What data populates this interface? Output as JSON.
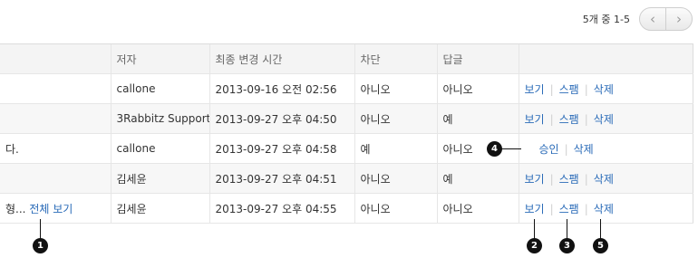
{
  "pagination": {
    "info": "5개 중 1-5",
    "prev_icon": "chevron-left-icon",
    "next_icon": "chevron-right-icon"
  },
  "columns": [
    "",
    "저자",
    "최종 변경 시간",
    "차단",
    "답글",
    ""
  ],
  "rows": [
    {
      "text": "",
      "author": "callone",
      "time": "2013-09-16 오전 02:56",
      "blocked": "아니오",
      "reply": "아니오",
      "actions": [
        "보기",
        "스팸",
        "삭제"
      ]
    },
    {
      "text": "",
      "author": "3Rabbitz Support",
      "time": "2013-09-27 오후 04:50",
      "blocked": "아니오",
      "reply": "예",
      "actions": [
        "보기",
        "스팸",
        "삭제"
      ]
    },
    {
      "text": "다.",
      "author": "callone",
      "time": "2013-09-27 오후 04:58",
      "blocked": "예",
      "reply": "아니오",
      "actions": [
        "승인",
        "삭제"
      ]
    },
    {
      "text": "",
      "author": "김세윤",
      "time": "2013-09-27 오후 04:51",
      "blocked": "아니오",
      "reply": "예",
      "actions": [
        "보기",
        "스팸",
        "삭제"
      ]
    },
    {
      "text": "형...",
      "text_link": "전체 보기",
      "author": "김세윤",
      "time": "2013-09-27 오후 04:55",
      "blocked": "아니오",
      "reply": "아니오",
      "actions": [
        "보기",
        "스팸",
        "삭제"
      ]
    }
  ],
  "callouts": [
    "1",
    "2",
    "3",
    "4",
    "5"
  ]
}
